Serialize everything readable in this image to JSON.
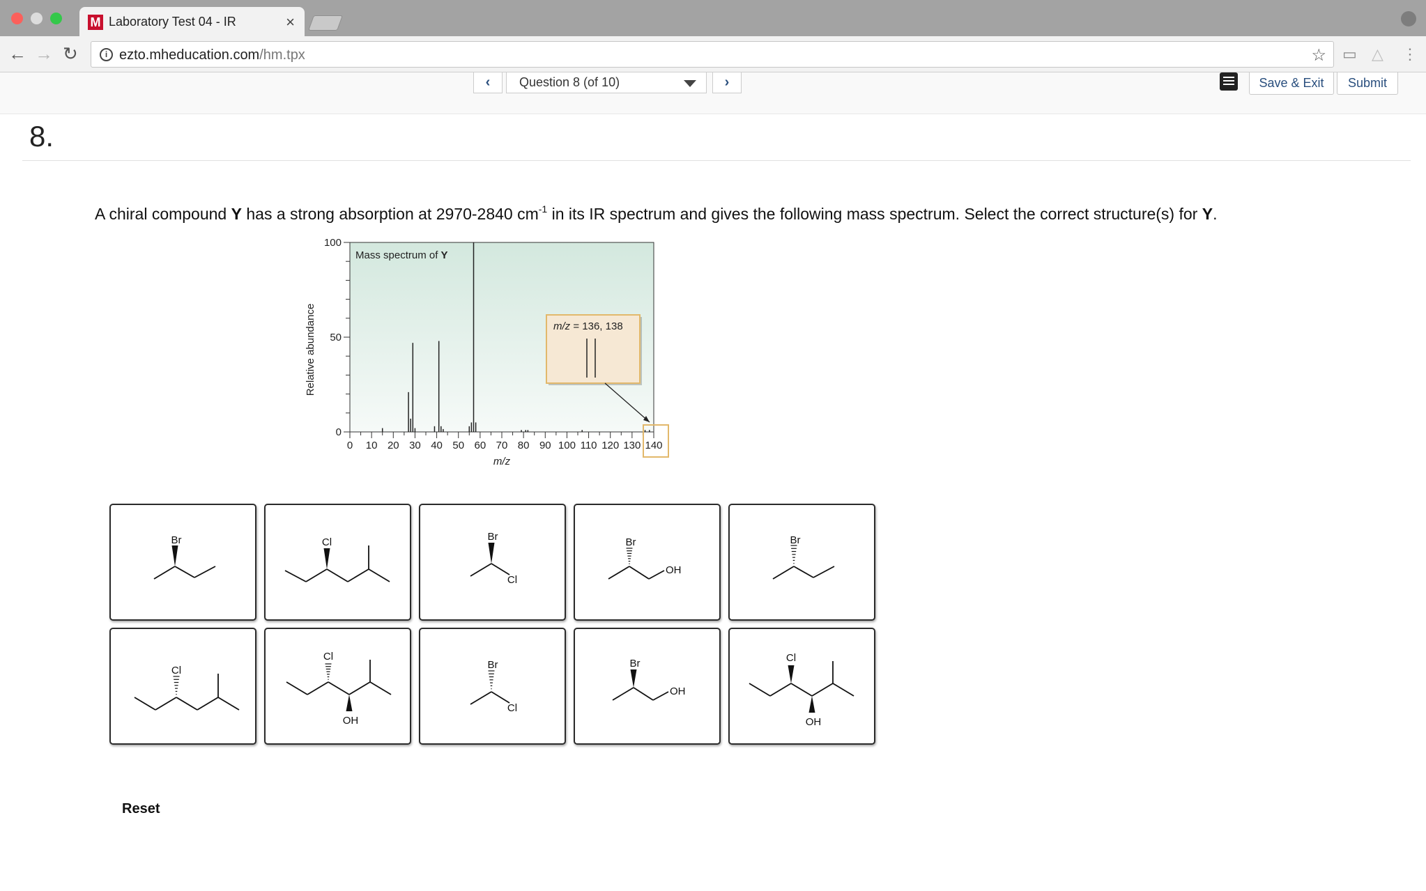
{
  "browser": {
    "tab_title": "Laboratory Test 04 - IR",
    "favicon_letter": "M",
    "url_host": "ezto.mheducation.com",
    "url_path": "/hm.tpx"
  },
  "question_nav": {
    "selected": "Question 8 (of 10)",
    "save_exit_label": "Save & Exit",
    "submit_label": "Submit"
  },
  "question": {
    "number": "8.",
    "prompt_part1": "A chiral compound ",
    "compound": "Y",
    "prompt_part2": " has a strong absorption at 2970-2840 cm",
    "prompt_sup": "-1",
    "prompt_part3": " in its IR spectrum and gives the following mass spectrum.  Select the correct structure(s) for ",
    "prompt_end": "."
  },
  "chart_data": {
    "type": "bar",
    "title": "Mass spectrum of Y",
    "xlabel": "m/z",
    "ylabel": "Relative abundance",
    "xlim": [
      0,
      140
    ],
    "ylim": [
      0,
      100
    ],
    "x_ticks": [
      0,
      10,
      20,
      30,
      40,
      50,
      60,
      70,
      80,
      90,
      100,
      110,
      120,
      130,
      140
    ],
    "y_ticks": [
      0,
      50,
      100
    ],
    "peaks": [
      {
        "mz": 15,
        "abundance": 2
      },
      {
        "mz": 27,
        "abundance": 21
      },
      {
        "mz": 28,
        "abundance": 7
      },
      {
        "mz": 29,
        "abundance": 47
      },
      {
        "mz": 30,
        "abundance": 2
      },
      {
        "mz": 39,
        "abundance": 3
      },
      {
        "mz": 41,
        "abundance": 48
      },
      {
        "mz": 42,
        "abundance": 3
      },
      {
        "mz": 43,
        "abundance": 1.5
      },
      {
        "mz": 55,
        "abundance": 3
      },
      {
        "mz": 56,
        "abundance": 5
      },
      {
        "mz": 57,
        "abundance": 100
      },
      {
        "mz": 58,
        "abundance": 5
      },
      {
        "mz": 79,
        "abundance": 1
      },
      {
        "mz": 81,
        "abundance": 1
      },
      {
        "mz": 82,
        "abundance": 1
      },
      {
        "mz": 107,
        "abundance": 1
      },
      {
        "mz": 136,
        "abundance": 1
      },
      {
        "mz": 138,
        "abundance": 1
      }
    ],
    "inset": {
      "label_var": "m/z",
      "label_values": "= 136, 138",
      "peaks": [
        136,
        138
      ]
    }
  },
  "choices": [
    {
      "id": "A",
      "substituent": "Br",
      "shape": "butyl-wedge-up"
    },
    {
      "id": "B",
      "substituent": "Cl",
      "shape": "branched-wedge"
    },
    {
      "id": "C",
      "substituent": "Br",
      "substituent2": "Cl",
      "shape": "dihalo-wedge"
    },
    {
      "id": "D",
      "substituent": "Br",
      "substituent2": "OH",
      "shape": "halohydrin-hash"
    },
    {
      "id": "E",
      "substituent": "Br",
      "shape": "butyl-hash"
    },
    {
      "id": "F",
      "substituent": "Cl",
      "shape": "branched-hash"
    },
    {
      "id": "G",
      "substituent": "Cl",
      "substituent2": "OH",
      "shape": "diol-like-hash-wedge"
    },
    {
      "id": "H",
      "substituent": "Br",
      "substituent2": "Cl",
      "shape": "dihalo-hash"
    },
    {
      "id": "I",
      "substituent": "Br",
      "substituent2": "OH",
      "shape": "halohydrin-wedge"
    },
    {
      "id": "J",
      "substituent": "Cl",
      "substituent2": "OH",
      "shape": "diol-like-wedge-wedge"
    }
  ],
  "reset_label": "Reset"
}
